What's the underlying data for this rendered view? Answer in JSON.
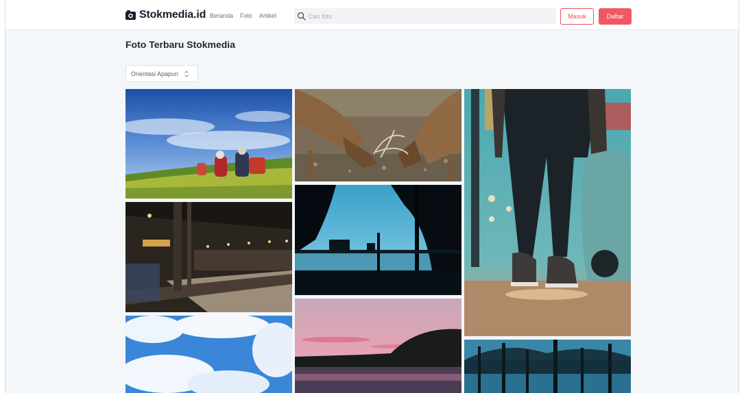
{
  "header": {
    "logo_text": "Stokmedia.id",
    "nav": [
      "Beranda",
      "Foto",
      "Artikel"
    ],
    "search_placeholder": "Cari foto",
    "login_label": "Masuk",
    "register_label": "Daftar"
  },
  "main": {
    "title": "Foto Terbaru Stokmedia",
    "orientation_filter": "Orientasi Apapun"
  },
  "colors": {
    "accent": "#ef5a62",
    "background": "#f4f7fa"
  },
  "icons": [
    "logo-icon",
    "search-icon",
    "chevron-updown-icon"
  ]
}
